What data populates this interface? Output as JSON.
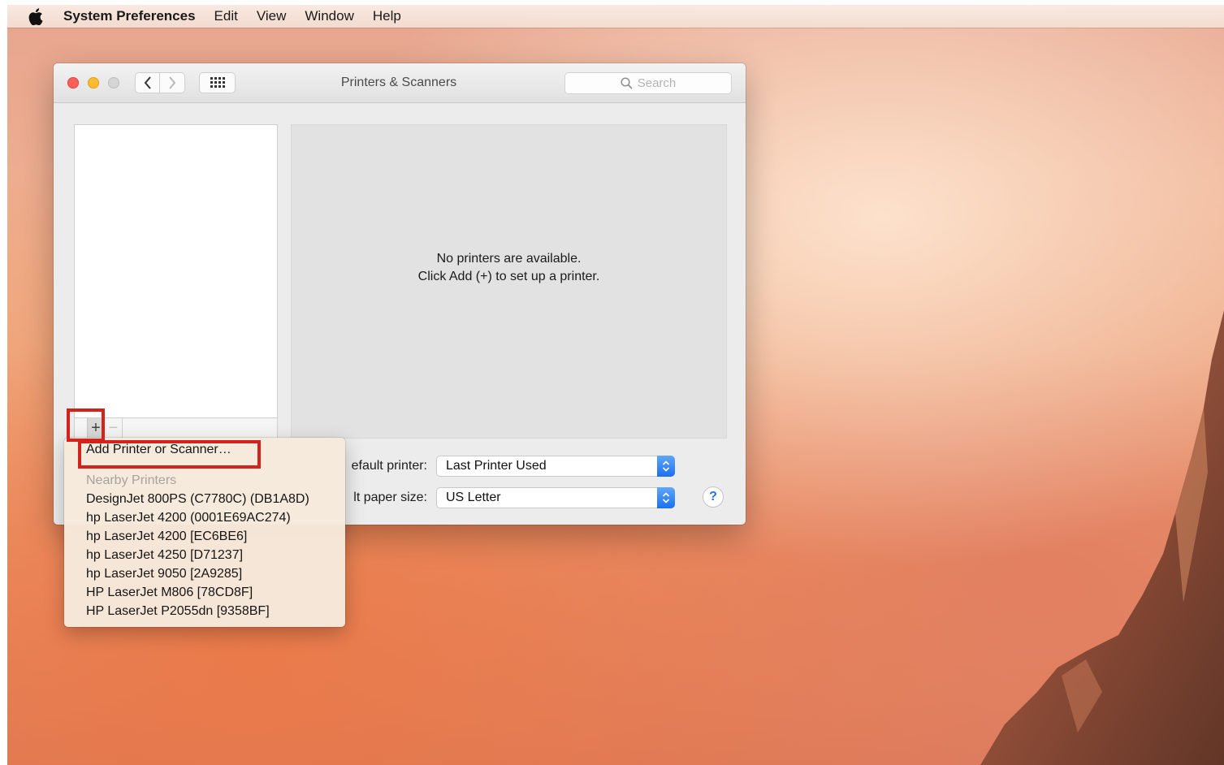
{
  "menubar": {
    "app_name": "System Preferences",
    "items": [
      "Edit",
      "View",
      "Window",
      "Help"
    ]
  },
  "window": {
    "title": "Printers & Scanners",
    "search_placeholder": "Search",
    "empty_message_line1": "No printers are available.",
    "empty_message_line2": "Click Add (+) to set up a printer.",
    "default_printer_label": "efault printer:",
    "default_printer_value": "Last Printer Used",
    "paper_size_label": "lt paper size:",
    "paper_size_value": "US Letter",
    "help_label": "?",
    "add_label": "+",
    "remove_label": "−"
  },
  "dropdown": {
    "add_item": "Add Printer or Scanner…",
    "nearby_header": "Nearby Printers",
    "printers": [
      "DesignJet 800PS (C7780C) (DB1A8D)",
      "hp LaserJet 4200 (0001E69AC274)",
      "hp LaserJet 4200 [EC6BE6]",
      "hp LaserJet 4250 [D71237]",
      "hp LaserJet 9050 [2A9285]",
      "HP LaserJet M806 [78CD8F]",
      "HP LaserJet P2055dn [9358BF]"
    ]
  },
  "colors": {
    "annotation_red": "#d2231c",
    "accent_blue": "#1b6ff0"
  }
}
